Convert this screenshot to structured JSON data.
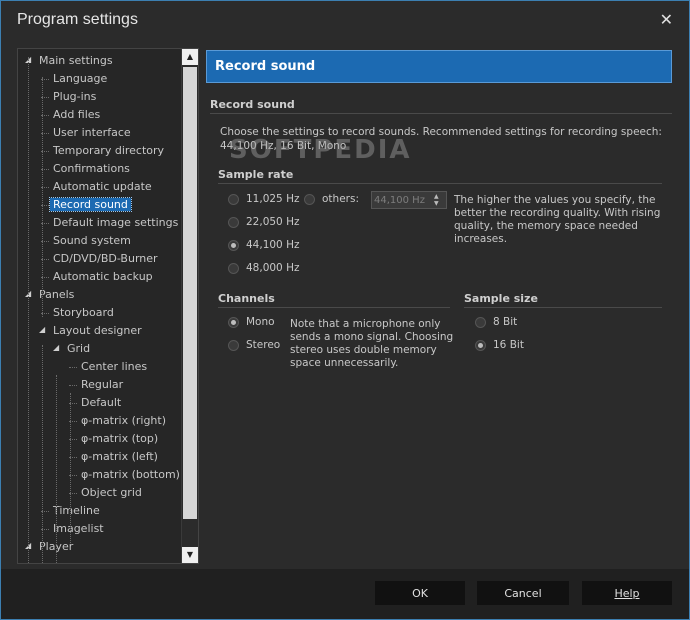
{
  "window": {
    "title": "Program settings",
    "close": "✕"
  },
  "tree": {
    "items": [
      {
        "label": "Main settings",
        "level": 0,
        "expander": "◢"
      },
      {
        "label": "Language",
        "level": 1
      },
      {
        "label": "Plug-ins",
        "level": 1
      },
      {
        "label": "Add files",
        "level": 1
      },
      {
        "label": "User interface",
        "level": 1
      },
      {
        "label": "Temporary directory",
        "level": 1
      },
      {
        "label": "Confirmations",
        "level": 1
      },
      {
        "label": "Automatic update",
        "level": 1
      },
      {
        "label": "Record sound",
        "level": 1,
        "selected": true
      },
      {
        "label": "Default image settings",
        "level": 1
      },
      {
        "label": "Sound system",
        "level": 1
      },
      {
        "label": "CD/DVD/BD-Burner",
        "level": 1
      },
      {
        "label": "Automatic backup",
        "level": 1
      },
      {
        "label": "Panels",
        "level": 0,
        "expander": "◢"
      },
      {
        "label": "Storyboard",
        "level": 1
      },
      {
        "label": "Layout designer",
        "level": 1,
        "expander": "◢"
      },
      {
        "label": "Grid",
        "level": 2,
        "expander": "◢"
      },
      {
        "label": "Center lines",
        "level": 3
      },
      {
        "label": "Regular",
        "level": 3
      },
      {
        "label": "Default",
        "level": 3
      },
      {
        "label": "φ-matrix (right)",
        "level": 3
      },
      {
        "label": "φ-matrix (top)",
        "level": 3
      },
      {
        "label": "φ-matrix (left)",
        "level": 3
      },
      {
        "label": "φ-matrix (bottom)",
        "level": 3
      },
      {
        "label": "Object grid",
        "level": 3
      },
      {
        "label": "Timeline",
        "level": 1
      },
      {
        "label": "Imagelist",
        "level": 1
      },
      {
        "label": "Player",
        "level": 0,
        "expander": "◢"
      }
    ],
    "scroll_up": "▲",
    "scroll_down": "▼"
  },
  "content": {
    "header": "Record sound",
    "section_title": "Record sound",
    "description_line1": "Choose the settings to record sounds. Recommended settings for recording speech:",
    "description_line2": "44,100 Hz, 16 Bit, Mono",
    "sample_rate": {
      "title": "Sample rate",
      "options": [
        "11,025 Hz",
        "22,050 Hz",
        "44,100 Hz",
        "48,000 Hz"
      ],
      "selected": "44,100 Hz",
      "others_label": "others:",
      "others_value": "44,100 Hz",
      "hint_lines": [
        "The higher the values you specify, the",
        "better the recording quality. With rising",
        "quality, the memory space needed",
        "increases."
      ]
    },
    "channels": {
      "title": "Channels",
      "options": [
        "Mono",
        "Stereo"
      ],
      "selected": "Mono",
      "hint_lines": [
        "Note that a microphone only",
        "sends a mono signal. Choosing",
        "stereo uses double memory",
        "space unnecessarily."
      ]
    },
    "sample_size": {
      "title": "Sample size",
      "options": [
        "8 Bit",
        "16 Bit"
      ],
      "selected": "16 Bit"
    },
    "watermark": "SOFTPEDIA"
  },
  "footer": {
    "ok": "OK",
    "cancel": "Cancel",
    "help": "Help"
  }
}
